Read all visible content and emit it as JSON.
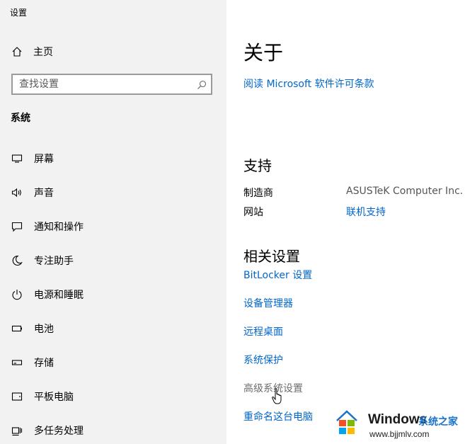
{
  "window": {
    "title": "设置"
  },
  "sidebar": {
    "home": {
      "label": "主页",
      "icon": "home-icon"
    },
    "search": {
      "placeholder": "查找设置",
      "icon": "search-icon"
    },
    "section_title": "系统",
    "items": [
      {
        "label": "屏幕",
        "icon": "monitor-icon"
      },
      {
        "label": "声音",
        "icon": "speaker-icon"
      },
      {
        "label": "通知和操作",
        "icon": "notification-icon"
      },
      {
        "label": "专注助手",
        "icon": "moon-icon"
      },
      {
        "label": "电源和睡眠",
        "icon": "power-icon"
      },
      {
        "label": "电池",
        "icon": "battery-icon"
      },
      {
        "label": "存储",
        "icon": "storage-icon"
      },
      {
        "label": "平板电脑",
        "icon": "tablet-icon"
      },
      {
        "label": "多任务处理",
        "icon": "multitasking-icon"
      }
    ]
  },
  "main": {
    "title": "关于",
    "license_link": "阅读 Microsoft 软件许可条款",
    "support": {
      "heading": "支持",
      "manufacturer_label": "制造商",
      "manufacturer_value": "ASUSTeK Computer Inc.",
      "website_label": "网站",
      "website_link": "联机支持"
    },
    "related": {
      "heading": "相关设置",
      "links": [
        "BitLocker 设置",
        "设备管理器",
        "远程桌面",
        "系统保护"
      ],
      "hovered_link": "高级系统设置",
      "last_link": "重命名这台电脑"
    }
  },
  "watermark": {
    "brand": "Windows",
    "brand_cn": "系统之家",
    "url": "www.bjjmlv.com"
  },
  "colors": {
    "link": "#0066cc",
    "sidebar_bg": "#f2f2f2"
  }
}
